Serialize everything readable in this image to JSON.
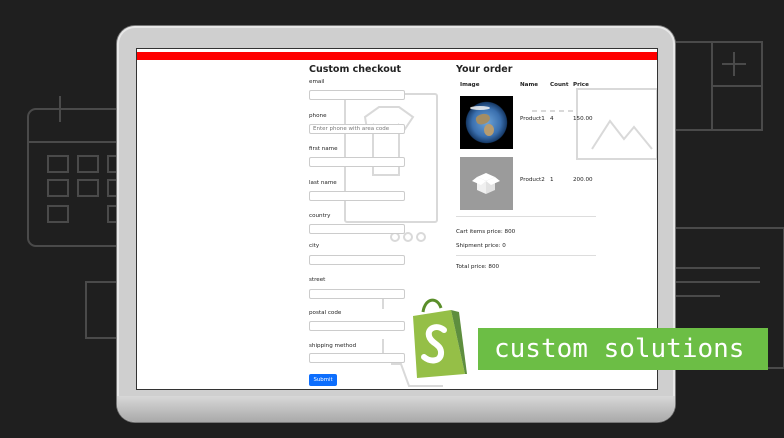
{
  "brand": {
    "tagline": "custom solutions"
  },
  "checkout": {
    "title": "Custom checkout",
    "fields": [
      {
        "label": "email",
        "placeholder": ""
      },
      {
        "label": "phone",
        "placeholder": "Enter phone with area code"
      },
      {
        "label": "first name",
        "placeholder": ""
      },
      {
        "label": "last name",
        "placeholder": ""
      },
      {
        "label": "country",
        "placeholder": ""
      },
      {
        "label": "city",
        "placeholder": ""
      },
      {
        "label": "street",
        "placeholder": ""
      },
      {
        "label": "postal code",
        "placeholder": ""
      },
      {
        "label": "shipping method",
        "placeholder": ""
      }
    ],
    "submit_label": "Submit"
  },
  "order": {
    "title": "Your order",
    "columns": [
      "Image",
      "Name",
      "Count",
      "Price"
    ],
    "rows": [
      {
        "image": "earth-image",
        "name": "Product1",
        "count": "4",
        "price": "150.00"
      },
      {
        "image": "box-image",
        "name": "Product2",
        "count": "1",
        "price": "200.00"
      }
    ],
    "cart_items_price": "Cart items price: 800",
    "shipment_price": "Shipment price: 0",
    "total_price": "Total price: 800"
  },
  "colors": {
    "topbar": "#ff0000",
    "submit": "#0d6efd",
    "banner": "#6cbe45",
    "background": "#1f1f1f"
  }
}
